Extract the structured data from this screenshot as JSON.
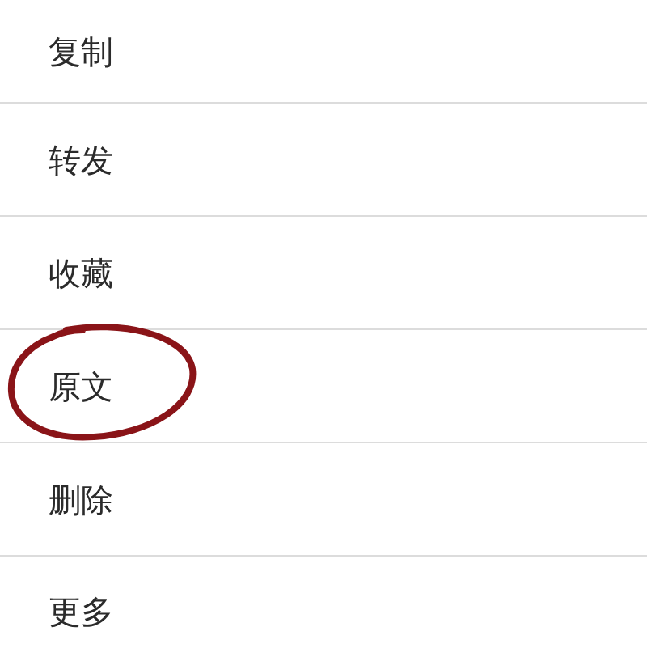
{
  "menu": {
    "items": [
      {
        "label": "复制",
        "circled": false
      },
      {
        "label": "转发",
        "circled": false
      },
      {
        "label": "收藏",
        "circled": false
      },
      {
        "label": "原文",
        "circled": true
      },
      {
        "label": "删除",
        "circled": false
      },
      {
        "label": "更多",
        "circled": false
      }
    ]
  }
}
